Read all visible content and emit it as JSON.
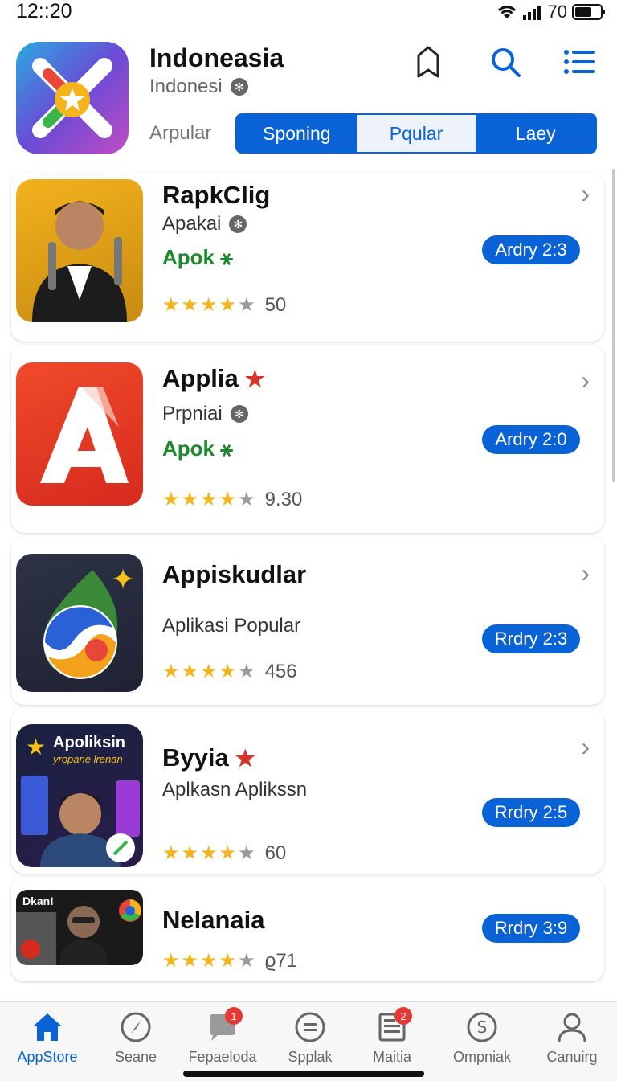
{
  "status": {
    "time": "12::20",
    "battery_text": "70"
  },
  "header": {
    "title": "Indoneasia",
    "subtitle": "Indonesi",
    "segment_label": "Arpular",
    "segments": [
      "Sponing",
      "Pqular",
      "Laey"
    ],
    "active_segment": "Pqular"
  },
  "apps": [
    {
      "name": "RapkClig",
      "subtitle": "Apakai",
      "tag": "Apok ⚹",
      "rating_value": "50",
      "rating_stars": 4,
      "action": "Ardry 2:3"
    },
    {
      "name": "Applia",
      "subtitle": "Prpniai",
      "tag": "Apok ⚹",
      "rating_value": "9.30",
      "rating_stars": 4,
      "action": "Ardry 2:0"
    },
    {
      "name": "Appiskudlar",
      "subtitle": "Aplikasi Popular",
      "tag": "",
      "rating_value": "456",
      "rating_stars": 4,
      "action": "Rrdry 2:3"
    },
    {
      "name": "Byyia",
      "subtitle": "Aplkasn Aplikssn",
      "tag": "",
      "rating_value": "60",
      "rating_stars": 4,
      "action": "Rrdry 2:5",
      "thumb_title": "Apoliksin",
      "thumb_sub": "yropane lrenan"
    },
    {
      "name": "Nelanaia",
      "subtitle": "",
      "tag": "",
      "rating_value": "ϱ71",
      "rating_stars": 4,
      "action": "Rrdry 3:9",
      "thumb_title": "Dkan!"
    }
  ],
  "tabs": [
    {
      "label": "AppStore",
      "icon": "home-icon",
      "badge": ""
    },
    {
      "label": "Seane",
      "icon": "compass-icon",
      "badge": ""
    },
    {
      "label": "Fepaeloda",
      "icon": "chat-bubble-icon",
      "badge": "1"
    },
    {
      "label": "Spplak",
      "icon": "list-circle-icon",
      "badge": ""
    },
    {
      "label": "Maitia",
      "icon": "news-icon",
      "badge": "2"
    },
    {
      "label": "Ompniak",
      "icon": "dollar-circle-icon",
      "badge": ""
    },
    {
      "label": "Canuirg",
      "icon": "person-icon",
      "badge": ""
    }
  ],
  "colors": {
    "accent": "#0a63d6",
    "tag_green": "#1a8a2a",
    "star": "#f2b51f",
    "badge_red": "#e53935"
  }
}
